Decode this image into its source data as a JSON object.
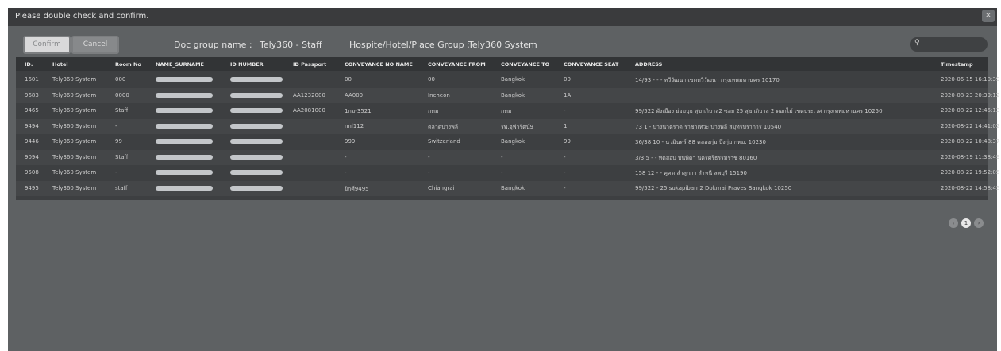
{
  "dialog": {
    "title": "Please double check and confirm.",
    "close_label": "×"
  },
  "actions": {
    "confirm_label": "Confirm",
    "cancel_label": "Cancel"
  },
  "info": {
    "doc_group_label": "Doc group name :",
    "doc_group_value": "Tely360 - Staff",
    "place_group_label": "Hospite/Hotel/Place Group :",
    "place_group_value": "Tely360 System"
  },
  "search": {
    "icon": "search-icon",
    "placeholder": ""
  },
  "table": {
    "columns": [
      "ID.",
      "Hotel",
      "Room No",
      "NAME_SURNAME",
      "ID NUMBER",
      "ID Passport",
      "CONVEYANCE NO NAME",
      "CONVEYANCE FROM",
      "CONVEYANCE TO",
      "CONVEYANCE SEAT",
      "ADDRESS",
      "Timestamp"
    ],
    "rows": [
      {
        "id": "1601",
        "hotel": "Tely360 System",
        "room": "000",
        "passport": "",
        "conv_name": "00",
        "conv_from": "00",
        "conv_to": "Bangkok",
        "seat": "00",
        "address": "14/93 - - - ทวีวัฒนา เขตทวีวัฒนา กรุงเทพมหานคร 10170",
        "timestamp": "2020-06-15 16:10:39"
      },
      {
        "id": "9683",
        "hotel": "Tely360 System",
        "room": "0000",
        "passport": "AA1232000",
        "conv_name": "AA000",
        "conv_from": "Incheon",
        "conv_to": "Bangkok",
        "seat": "1A",
        "address": "",
        "timestamp": "2020-08-23 20:39:12"
      },
      {
        "id": "9465",
        "hotel": "Tely360 System",
        "room": "Staff",
        "passport": "AA2081000",
        "conv_name": "1กม-3521",
        "conv_from": "กทม",
        "conv_to": "กทม",
        "seat": "-",
        "address": "99/522 ผังเมือง ย่อมบุธ สุขาภิบาล2 ซอย 25 สุขาภิบาล 2 ดอกไม้ เขตประเวศ กรุงเทพมหานคร 10250",
        "timestamp": "2020-08-22 12:45:13"
      },
      {
        "id": "9494",
        "hotel": "Tely360 System",
        "room": "-",
        "passport": "",
        "conv_name": "nnl112",
        "conv_from": "ตลาดบางพลี",
        "conv_to": "รพ.จุฬารัตน์9",
        "seat": "1",
        "address": "73 1 - บางนาตราด ราชาเทวะ บางพลี สมุทรปราการ 10540",
        "timestamp": "2020-08-22 14:41:02"
      },
      {
        "id": "9446",
        "hotel": "Tely360 System",
        "room": "99",
        "passport": "",
        "conv_name": "999",
        "conv_from": "Switzerland",
        "conv_to": "Bangkok",
        "seat": "99",
        "address": "36/38 10 - นวมินทร์ 88 คลองกุ่ม บึงกุ่ม กทม. 10230",
        "timestamp": "2020-08-22 10:48:37"
      },
      {
        "id": "9094",
        "hotel": "Tely360 System",
        "room": "Staff",
        "passport": "",
        "conv_name": "-",
        "conv_from": "-",
        "conv_to": "-",
        "seat": "-",
        "address": "3/3 5 - - ทดสอบ บนพิดา นครศรีธรรมราช 80160",
        "timestamp": "2020-08-19 11:38:49"
      },
      {
        "id": "9508",
        "hotel": "Tely360 System",
        "room": "-",
        "passport": "",
        "conv_name": "-",
        "conv_from": "-",
        "conv_to": "-",
        "seat": "-",
        "address": "158 12 - - คูคต ลำลูกกา ลำหนี ลพบุรี 15190",
        "timestamp": "2020-08-22 19:52:05"
      },
      {
        "id": "9495",
        "hotel": "Tely360 System",
        "room": "staff",
        "passport": "",
        "conv_name": "ยิกศ์9495",
        "conv_from": "Chiangrai",
        "conv_to": "Bangkok",
        "seat": "-",
        "address": "99/522 - 25 sukapibarn2 Dokmai Praves Bangkok 10250",
        "timestamp": "2020-08-22 14:58:45"
      }
    ]
  },
  "pagination": {
    "prev_label": "‹",
    "current_page": "1",
    "next_label": "›"
  }
}
